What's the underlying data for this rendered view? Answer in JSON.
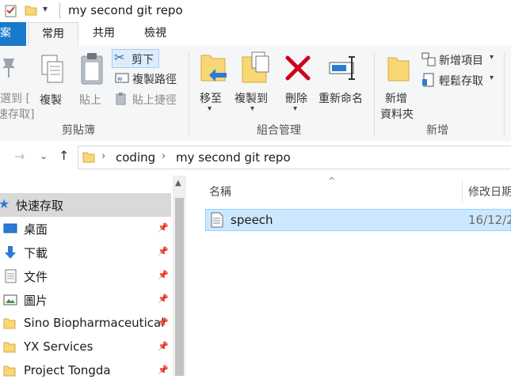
{
  "titlebar": {
    "title": "my second git repo"
  },
  "tabs": {
    "file": "案",
    "home": "常用",
    "share": "共用",
    "view": "檢視"
  },
  "ribbon": {
    "clipboard": {
      "pin_line1": "選到 [",
      "pin_line2": "速存取]",
      "copy": "複製",
      "paste": "貼上",
      "cut": "剪下",
      "copy_path": "複製路徑",
      "paste_shortcut": "貼上捷徑",
      "group_label": "剪貼簿"
    },
    "organize": {
      "move_to": "移至",
      "copy_to": "複製到",
      "delete": "刪除",
      "rename": "重新命名",
      "group_label": "組合管理"
    },
    "new": {
      "new_folder_line1": "新增",
      "new_folder_line2": "資料夾",
      "new_item": "新增項目",
      "easy_access": "輕鬆存取",
      "group_label": "新增"
    }
  },
  "address": {
    "crumbs": [
      "coding",
      "my second git repo"
    ]
  },
  "nav": {
    "items": [
      {
        "label": "快速存取",
        "icon": "star-icon"
      },
      {
        "label": "桌面",
        "icon": "desktop-icon"
      },
      {
        "label": "下載",
        "icon": "download-icon"
      },
      {
        "label": "文件",
        "icon": "document-icon"
      },
      {
        "label": "圖片",
        "icon": "picture-icon"
      },
      {
        "label": "Sino Biopharmaceutical",
        "icon": "folder-icon"
      },
      {
        "label": "YX Services",
        "icon": "folder-icon"
      },
      {
        "label": "Project Tongda",
        "icon": "folder-icon"
      }
    ]
  },
  "list": {
    "columns": {
      "name": "名稱",
      "modified": "修改日期"
    },
    "files": [
      {
        "name": "speech",
        "modified": "16/12/2"
      }
    ]
  },
  "colors": {
    "accent": "#1979ca",
    "selection": "#cce8ff",
    "delete_red": "#d0021b",
    "folder_yellow": "#f8d775"
  }
}
